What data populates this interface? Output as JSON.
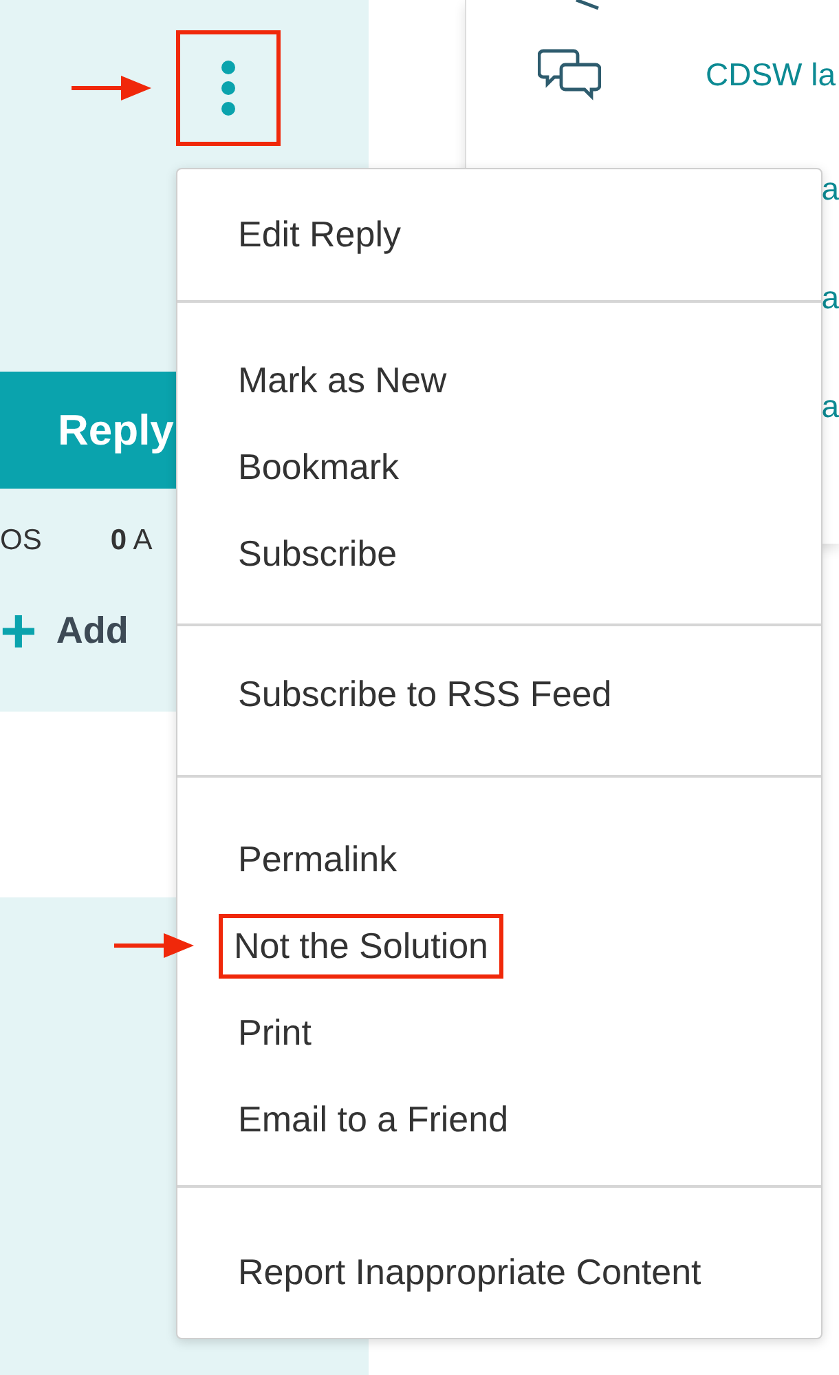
{
  "post_actions": {
    "menu_button": {
      "annotated": true
    },
    "reply_button": {
      "label": "Reply"
    },
    "stats": [
      {
        "label": "OS"
      },
      {
        "count": "0",
        "label": "A"
      }
    ],
    "add_tag": {
      "icon": "+",
      "label": "Add"
    }
  },
  "sidebar": {
    "links": [
      {
        "label": "CDSW la",
        "kind": "topic"
      },
      {
        "label": "a",
        "kind": "plain"
      },
      {
        "label": "a",
        "kind": "plain"
      },
      {
        "label": "a",
        "kind": "plain"
      }
    ]
  },
  "options_menu": {
    "sections": [
      {
        "items": [
          {
            "label": "Edit Reply",
            "annotated": false
          }
        ]
      },
      {
        "items": [
          {
            "label": "Mark as New",
            "annotated": false
          },
          {
            "label": "Bookmark",
            "annotated": false
          },
          {
            "label": "Subscribe",
            "annotated": false
          }
        ]
      },
      {
        "items": [
          {
            "label": "Subscribe to RSS Feed",
            "annotated": false
          }
        ]
      },
      {
        "items": [
          {
            "label": "Permalink",
            "annotated": false
          },
          {
            "label": "Not the Solution",
            "annotated": true
          },
          {
            "label": "Print",
            "annotated": false
          },
          {
            "label": "Email to a Friend",
            "annotated": false
          }
        ]
      },
      {
        "items": [
          {
            "label": "Report Inappropriate Content",
            "annotated": false
          }
        ]
      }
    ]
  }
}
